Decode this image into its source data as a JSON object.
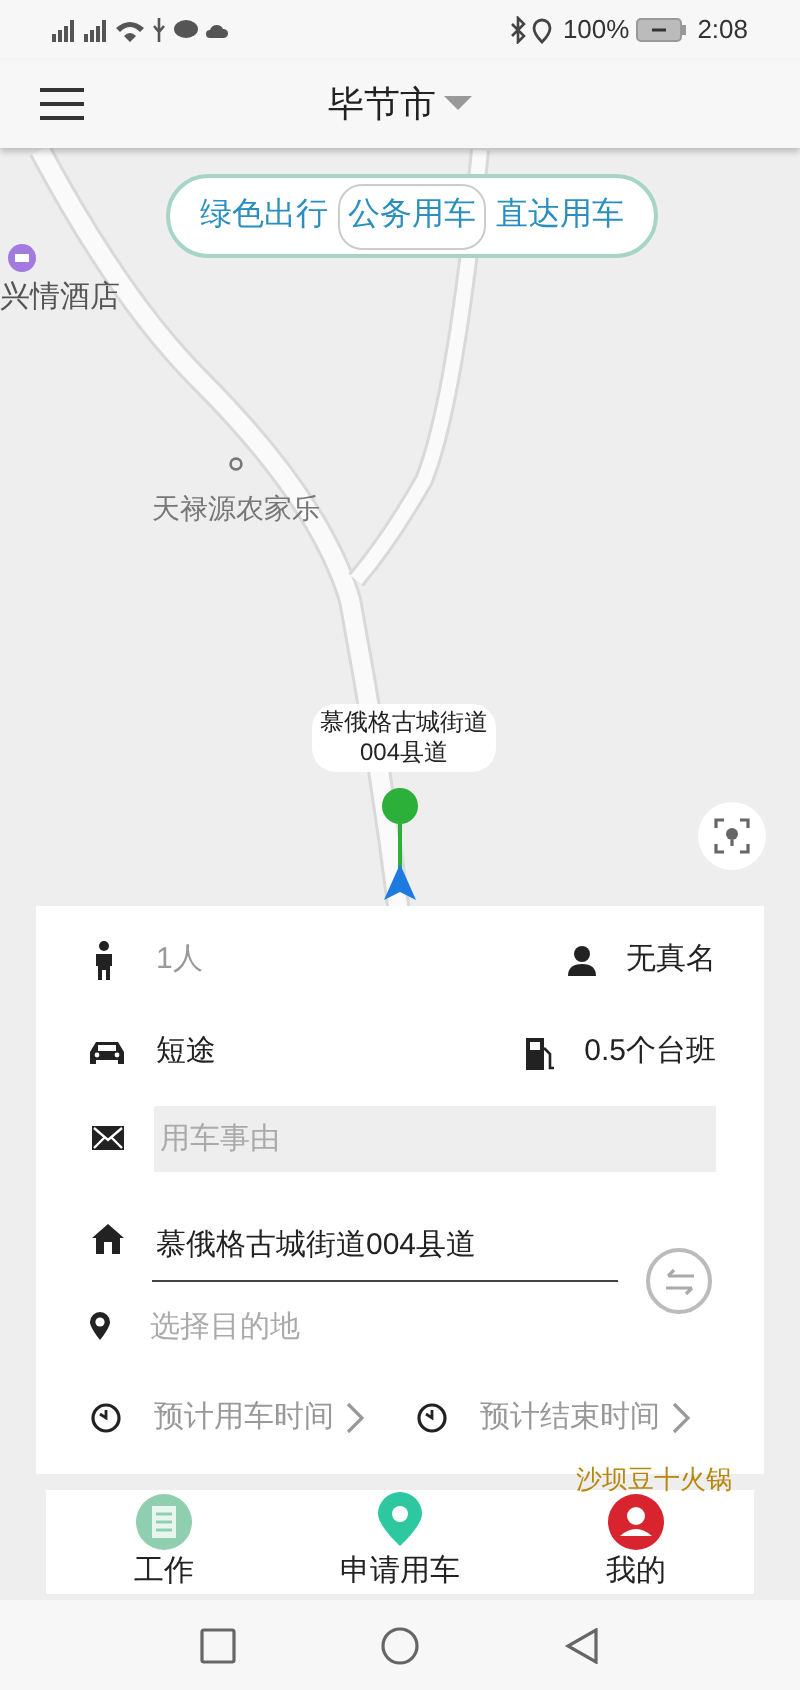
{
  "status_bar": {
    "battery": "100%",
    "time": "2:08"
  },
  "header": {
    "city": "毕节市"
  },
  "modes": [
    {
      "label": "绿色出行",
      "selected": false
    },
    {
      "label": "公务用车",
      "selected": true
    },
    {
      "label": "直达用车",
      "selected": false
    }
  ],
  "map": {
    "labels": [
      {
        "kind": "hotel",
        "text": "兴情酒店"
      },
      {
        "kind": "poi",
        "text": "天禄源农家乐"
      },
      {
        "kind": "restaurant",
        "text": "沙坝豆十火锅"
      }
    ],
    "pin_label": [
      "慕俄格古城街道",
      "004县道"
    ]
  },
  "form": {
    "passengers": "1人",
    "real_name": "无真名",
    "trip_type": "短途",
    "quota": "0.5个台班",
    "reason": {
      "placeholder": "用车事由"
    },
    "origin": "慕俄格古城街道004县道",
    "destination": {
      "placeholder": "选择目的地"
    },
    "start_time": "预计用车时间",
    "end_time": "预计结束时间"
  },
  "tabs": [
    {
      "kind": "work",
      "label": "工作"
    },
    {
      "kind": "apply",
      "label": "申请用车"
    },
    {
      "kind": "mine",
      "label": "我的"
    }
  ]
}
